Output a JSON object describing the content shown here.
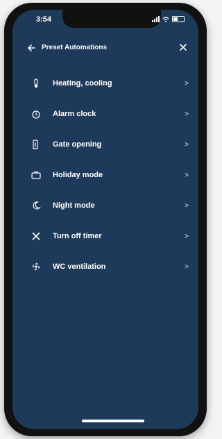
{
  "status": {
    "time": "3:54"
  },
  "header": {
    "title": "Preset Automations"
  },
  "items": [
    {
      "label": "Heating, cooling",
      "icon": "thermometer-icon"
    },
    {
      "label": "Alarm clock",
      "icon": "alarm-clock-icon"
    },
    {
      "label": "Gate opening",
      "icon": "gate-icon"
    },
    {
      "label": "Holiday mode",
      "icon": "suitcase-icon"
    },
    {
      "label": "Night mode",
      "icon": "moon-icon"
    },
    {
      "label": "Turn off timer",
      "icon": "timer-off-icon"
    },
    {
      "label": "WC ventilation",
      "icon": "fan-icon"
    }
  ],
  "colors": {
    "background": "#1e3a5b",
    "text": "#ffffff"
  }
}
